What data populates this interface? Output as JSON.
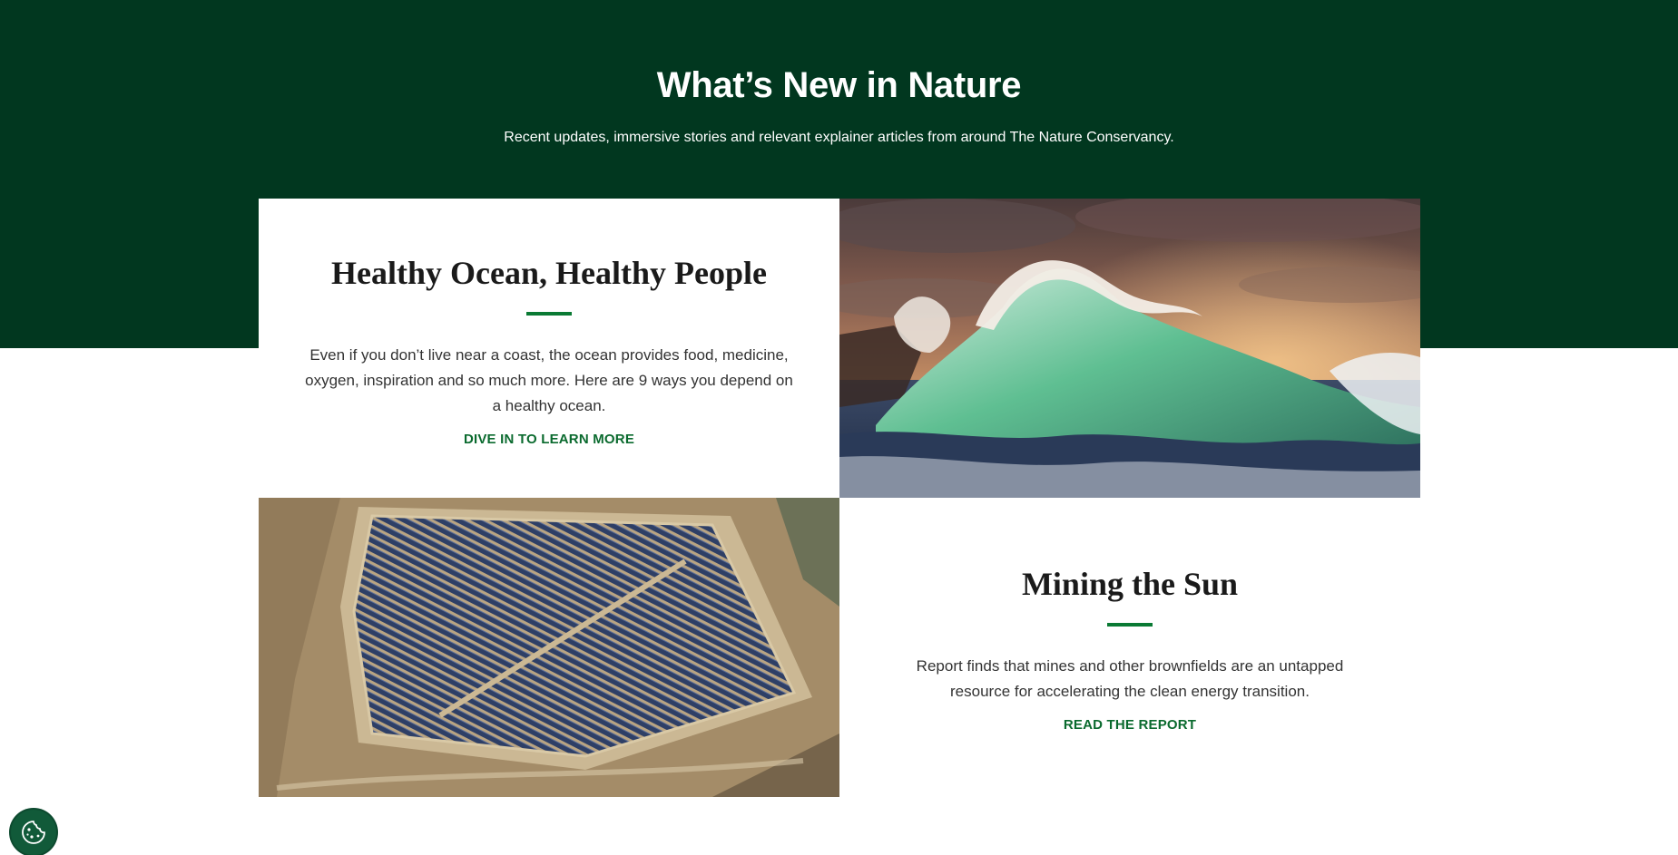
{
  "section": {
    "title": "What’s New in Nature",
    "subtitle": "Recent updates, immersive stories and relevant explainer articles from around The Nature Conservancy."
  },
  "cards": [
    {
      "title": "Healthy Ocean, Healthy People",
      "body": "Even if you don’t live near a coast, the ocean provides food, medicine, oxygen, inspiration and so much more. Here are 9 ways you depend on a healthy ocean.",
      "link": "DIVE IN TO LEARN MORE",
      "image_icon": "ocean-wave-photo"
    },
    {
      "title": "Mining the Sun",
      "body": "Report finds that mines and other brownfields are an untapped resource for accelerating the clean energy transition.",
      "link": "READ THE REPORT",
      "image_icon": "solar-farm-photo"
    }
  ],
  "cookie_button": {
    "icon": "cookie-icon"
  },
  "colors": {
    "hero_band": "#01371f",
    "accent_green": "#0a7a34",
    "link_green": "#0a6a2e"
  }
}
